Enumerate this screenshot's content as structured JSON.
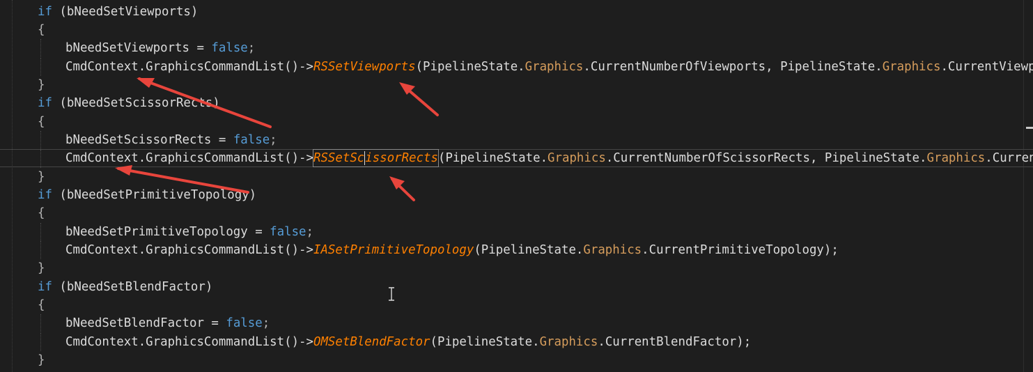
{
  "editor": {
    "lines": [
      {
        "indent": 1,
        "parts": [
          [
            "kw",
            "if"
          ],
          [
            "ident",
            " (bNeedSetViewports)"
          ]
        ]
      },
      {
        "indent": 1,
        "parts": [
          [
            "punc",
            "{"
          ]
        ]
      },
      {
        "indent": 2,
        "parts": [
          [
            "ident",
            "bNeedSetViewports = "
          ],
          [
            "kw",
            "false"
          ],
          [
            "punc",
            ";"
          ]
        ]
      },
      {
        "indent": 2,
        "parts": [
          [
            "ident",
            "CmdContext.GraphicsCommandList()->"
          ],
          [
            "fn",
            "RSSetViewports"
          ],
          [
            "ident",
            "(PipelineState."
          ],
          [
            "mem",
            "Graphics"
          ],
          [
            "ident",
            ".CurrentNumberOfViewports, PipelineState."
          ],
          [
            "mem",
            "Graphics"
          ],
          [
            "ident",
            ".CurrentViewports);"
          ]
        ]
      },
      {
        "indent": 1,
        "parts": [
          [
            "punc",
            "}"
          ]
        ]
      },
      {
        "indent": 1,
        "parts": [
          [
            "kw",
            "if"
          ],
          [
            "ident",
            " (bNeedSetScissorRects)"
          ]
        ]
      },
      {
        "indent": 1,
        "parts": [
          [
            "punc",
            "{"
          ]
        ]
      },
      {
        "indent": 2,
        "parts": [
          [
            "ident",
            "bNeedSetScissorRects = "
          ],
          [
            "kw",
            "false"
          ],
          [
            "punc",
            ";"
          ]
        ]
      },
      {
        "indent": 2,
        "current": true,
        "parts": [
          [
            "ident",
            "CmdContext.GraphicsCommandList()->"
          ],
          [
            "fn-box",
            "RSSetScissorRects"
          ],
          [
            "ident",
            "(PipelineState."
          ],
          [
            "mem",
            "Graphics"
          ],
          [
            "ident",
            ".CurrentNumberOfScissorRects, PipelineState."
          ],
          [
            "mem",
            "Graphics"
          ],
          [
            "ident",
            ".CurrentScissorRects);"
          ]
        ]
      },
      {
        "indent": 1,
        "parts": [
          [
            "punc",
            "}"
          ]
        ]
      },
      {
        "indent": 1,
        "parts": [
          [
            "kw",
            "if"
          ],
          [
            "ident",
            " (bNeedSetPrimitiveTopology)"
          ]
        ]
      },
      {
        "indent": 1,
        "parts": [
          [
            "punc",
            "{"
          ]
        ]
      },
      {
        "indent": 2,
        "parts": [
          [
            "ident",
            "bNeedSetPrimitiveTopology = "
          ],
          [
            "kw",
            "false"
          ],
          [
            "punc",
            ";"
          ]
        ]
      },
      {
        "indent": 2,
        "parts": [
          [
            "ident",
            "CmdContext.GraphicsCommandList()->"
          ],
          [
            "fn",
            "IASetPrimitiveTopology"
          ],
          [
            "ident",
            "(PipelineState."
          ],
          [
            "mem",
            "Graphics"
          ],
          [
            "ident",
            ".CurrentPrimitiveTopology);"
          ]
        ]
      },
      {
        "indent": 1,
        "parts": [
          [
            "punc",
            "}"
          ]
        ]
      },
      {
        "indent": 1,
        "parts": [
          [
            "kw",
            "if"
          ],
          [
            "ident",
            " (bNeedSetBlendFactor)"
          ]
        ]
      },
      {
        "indent": 1,
        "parts": [
          [
            "punc",
            "{"
          ]
        ]
      },
      {
        "indent": 2,
        "parts": [
          [
            "ident",
            "bNeedSetBlendFactor = "
          ],
          [
            "kw",
            "false"
          ],
          [
            "punc",
            ";"
          ]
        ]
      },
      {
        "indent": 2,
        "parts": [
          [
            "ident",
            "CmdContext.GraphicsCommandList()->"
          ],
          [
            "fn",
            "OMSetBlendFactor"
          ],
          [
            "ident",
            "(PipelineState."
          ],
          [
            "mem",
            "Graphics"
          ],
          [
            "ident",
            ".CurrentBlendFactor);"
          ]
        ]
      },
      {
        "indent": 1,
        "parts": [
          [
            "punc",
            "}"
          ]
        ]
      }
    ]
  },
  "colors": {
    "background": "#1e1e1e",
    "keyword": "#569cd6",
    "identifier": "#dcdcdc",
    "function": "#ff8000",
    "member": "#d69d5c",
    "annotation_arrow": "#e8453c"
  },
  "icons": {
    "mouse_cursor": "ibeam-cursor-icon"
  }
}
